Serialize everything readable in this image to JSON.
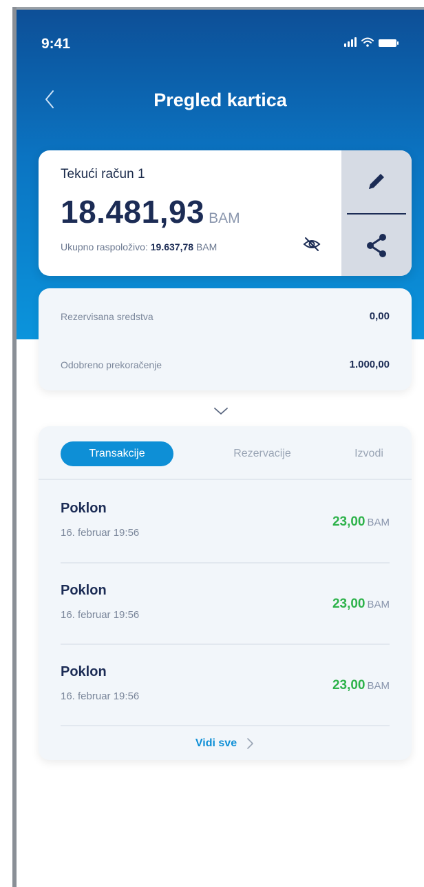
{
  "status": {
    "time": "9:41"
  },
  "header": {
    "title": "Pregled kartica"
  },
  "account": {
    "name": "Tekući račun 1",
    "balance": "18.481,93",
    "currency": "BAM",
    "available_label": "Ukupno raspoloživo:",
    "available_value": "19.637,78",
    "available_currency": "BAM"
  },
  "details": {
    "rows": [
      {
        "label": "Rezervisana sredstva",
        "value": "0,00"
      },
      {
        "label": "Odobreno prekoračenje",
        "value": "1.000,00"
      }
    ]
  },
  "tabs": [
    {
      "label": "Transakcije",
      "active": true
    },
    {
      "label": "Rezervacije",
      "active": false
    },
    {
      "label": "Izvodi",
      "active": false
    }
  ],
  "transactions": [
    {
      "name": "Poklon",
      "date": "16. februar 19:56",
      "amount": "23,00",
      "currency": "BAM"
    },
    {
      "name": "Poklon",
      "date": "16. februar 19:56",
      "amount": "23,00",
      "currency": "BAM"
    },
    {
      "name": "Poklon",
      "date": "16. februar 19:56",
      "amount": "23,00",
      "currency": "BAM"
    }
  ],
  "see_all": {
    "label": "Vidi sve"
  },
  "icons": {
    "back": "chevron-left-icon",
    "edit": "pencil-icon",
    "share": "share-icon",
    "hide_balance": "eye-off-icon",
    "expand": "chevron-down-icon",
    "see_all_arrow": "chevron-right-icon"
  },
  "colors": {
    "primary": "#0e8fd6",
    "header_dark": "#0d4f97",
    "text_dark": "#1c2c55",
    "amount_positive": "#2db24a"
  }
}
